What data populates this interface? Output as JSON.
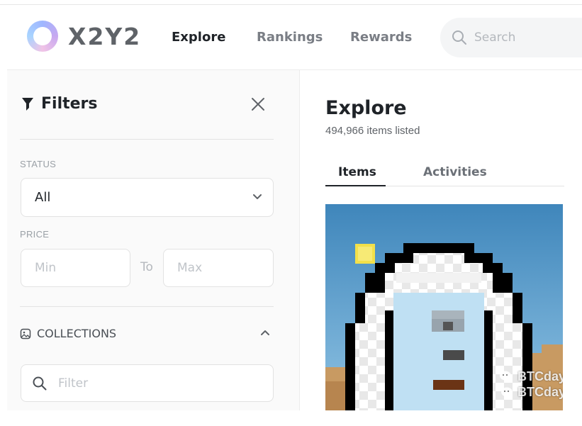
{
  "header": {
    "logo_text": "X2Y2",
    "nav": [
      {
        "label": "Explore",
        "active": true
      },
      {
        "label": "Rankings",
        "active": false
      },
      {
        "label": "Rewards",
        "active": false
      }
    ],
    "search_placeholder": "Search"
  },
  "sidebar": {
    "title": "Filters",
    "status_label": "STATUS",
    "status_value": "All",
    "price_label": "PRICE",
    "price_min_placeholder": "Min",
    "price_to": "To",
    "price_max_placeholder": "Max",
    "collections_label": "COLLECTIONS",
    "collections_filter_placeholder": "Filter"
  },
  "main": {
    "title": "Explore",
    "items_count": "494,966 items listed",
    "tabs": [
      {
        "label": "Items",
        "active": true
      },
      {
        "label": "Activities",
        "active": false
      }
    ]
  },
  "watermark": {
    "line1": "BTCdayu",
    "line2": "BTCdayu"
  },
  "colors": {
    "text_dark": "#1f2328",
    "text_muted": "#7a7e85",
    "sidebar_bg": "#fafafa",
    "nft_sky": "#4f8fc0",
    "nft_face": "#bfe0f3"
  },
  "icons": [
    "logo-ring-icon",
    "search-icon",
    "funnel-icon",
    "close-icon",
    "chevron-down-icon",
    "image-icon",
    "chevron-up-icon",
    "wechat-icon"
  ]
}
